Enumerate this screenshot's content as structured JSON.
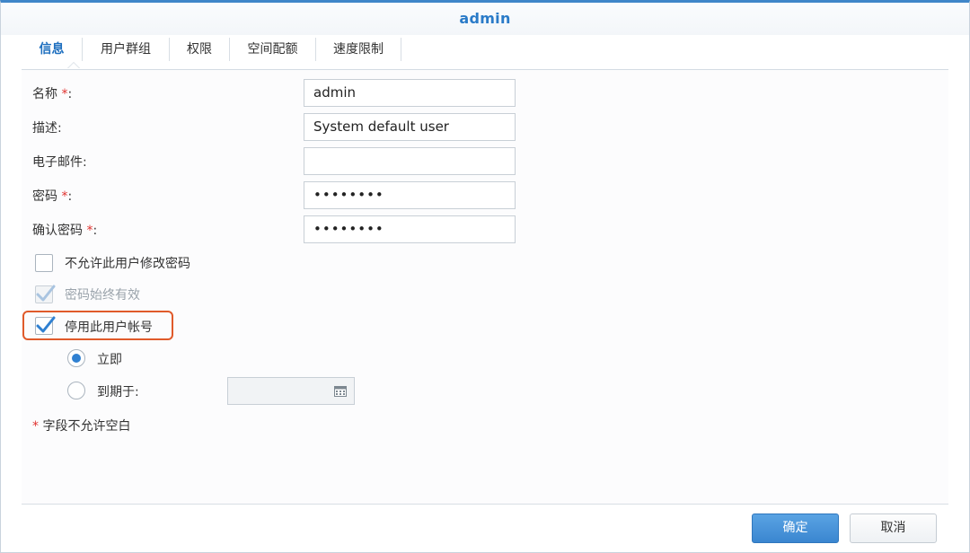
{
  "dialog": {
    "title": "admin"
  },
  "tabs": [
    {
      "label": "信息"
    },
    {
      "label": "用户群组"
    },
    {
      "label": "权限"
    },
    {
      "label": "空间配额"
    },
    {
      "label": "速度限制"
    }
  ],
  "form": {
    "name": {
      "label": "名称",
      "required_mark": "*",
      "suffix": ":",
      "value": "admin"
    },
    "description": {
      "label": "描述:",
      "value": "System default user"
    },
    "email": {
      "label": "电子邮件:",
      "value": ""
    },
    "password": {
      "label": "密码",
      "required_mark": "*",
      "suffix": ":",
      "value": "••••••••"
    },
    "confirm_password": {
      "label": "确认密码",
      "required_mark": "*",
      "suffix": ":",
      "value": "••••••••"
    }
  },
  "options": {
    "disallow_change_password": {
      "label": "不允许此用户修改密码",
      "checked": false
    },
    "password_never_expires": {
      "label": "密码始终有效",
      "checked": true,
      "disabled": true
    },
    "disable_account": {
      "label": "停用此用户帐号",
      "checked": true
    },
    "disable_immediately": {
      "label": "立即",
      "selected": true
    },
    "disable_on_date": {
      "label": "到期于:",
      "selected": false,
      "date_value": ""
    }
  },
  "note": {
    "mark": "*",
    "text": "字段不允许空白"
  },
  "buttons": {
    "ok": "确定",
    "cancel": "取消"
  },
  "colors": {
    "accent": "#2a7bc8",
    "highlight_border": "#e05a2a",
    "required": "#e0322f"
  },
  "icons": {
    "calendar": "calendar-icon",
    "checkmark": "checkmark-icon"
  }
}
